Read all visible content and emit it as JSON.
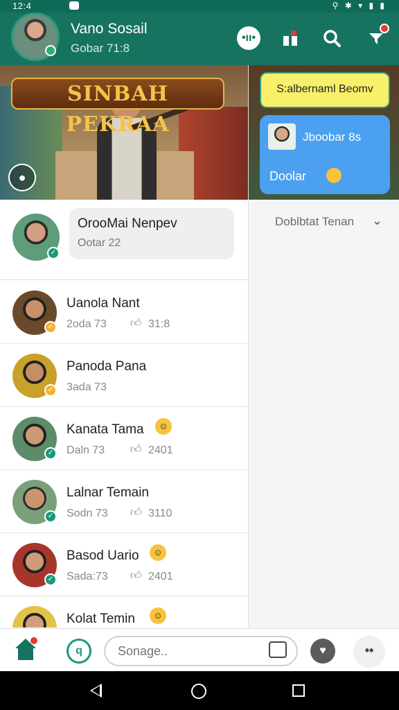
{
  "status_bar": {
    "time": "12:4"
  },
  "header": {
    "title": "Vano Sosail",
    "subtitle": "Gobar 71:8",
    "icons": [
      "voice-icon",
      "gift-icon",
      "search-icon",
      "notification-icon"
    ]
  },
  "banner": {
    "title": "SINBAH PEKRAA"
  },
  "featured": {
    "name": "OrooMai Nenpev",
    "meta": "Ootar 22"
  },
  "contacts": [
    {
      "name": "Uanola Nant",
      "sub": "2oda 73",
      "likes": "31:8",
      "emoji": false,
      "badge": "gold"
    },
    {
      "name": "Panoda Pana",
      "sub": "3ada 73",
      "likes": "",
      "emoji": false,
      "badge": "gold"
    },
    {
      "name": "Kanata Tama",
      "sub": "Daln 73",
      "likes": "2401",
      "emoji": true,
      "badge": "green"
    },
    {
      "name": "Lalnar Temain",
      "sub": "Sodn 73",
      "likes": "3110",
      "emoji": false,
      "badge": "green"
    },
    {
      "name": "Basod Uario",
      "sub": "Sada:73",
      "likes": "2401",
      "emoji": true,
      "badge": "green"
    },
    {
      "name": "Kolat Temin",
      "sub": "",
      "likes": "",
      "emoji": true,
      "badge": "gold"
    }
  ],
  "right_panel": {
    "yellow_bubble": "S:albernaml Beomv",
    "blue_bubble_line1": "Jboobar 8s",
    "blue_bubble_line2": "Doolar",
    "dropdown_label": "Doblbtat Tenan"
  },
  "composer": {
    "placeholder": "Sonage.."
  }
}
